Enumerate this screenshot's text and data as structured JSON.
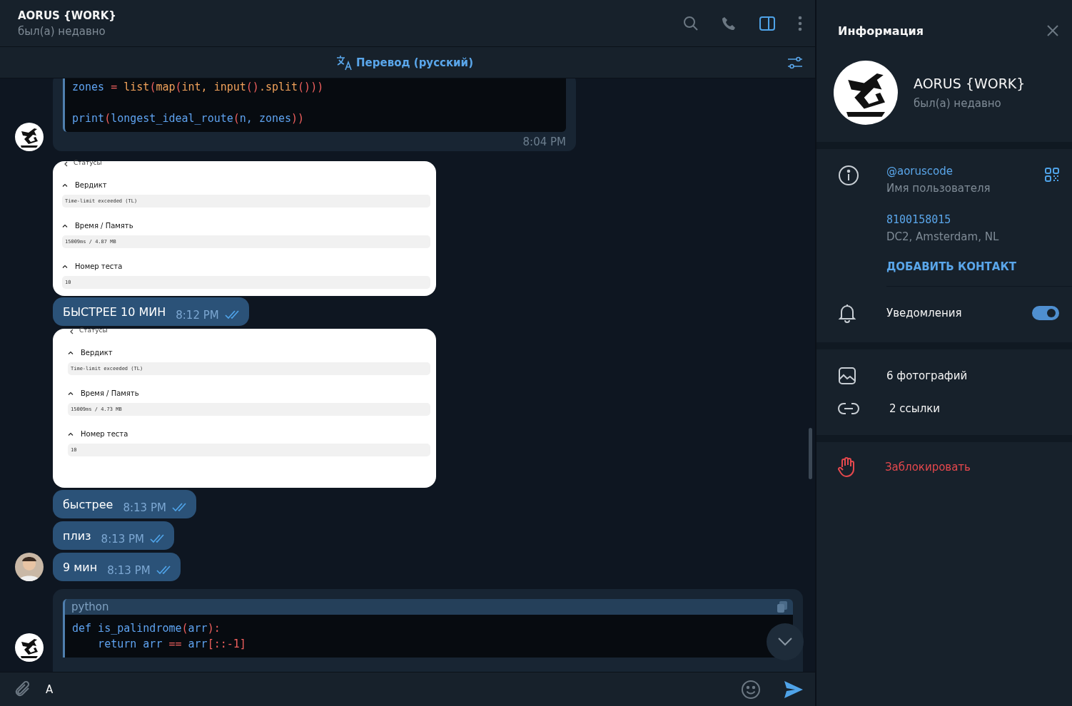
{
  "chat_header": {
    "title": "AORUS {WORK}",
    "status": "был(а) недавно"
  },
  "translate_bar": {
    "label": "Перевод (русский)"
  },
  "messages": [
    {
      "kind": "code",
      "avatar": {
        "kind": "logo"
      },
      "time": "8:04 PM",
      "lines": [
        {
          "kind": "code",
          "tokens": [
            {
              "t": "zones",
              "kind": "name"
            },
            {
              "t": " = ",
              "kind": "punct"
            },
            {
              "t": "list",
              "kind": "builtin"
            },
            {
              "t": "(",
              "kind": "punct"
            },
            {
              "t": "map",
              "kind": "builtin"
            },
            {
              "t": "(",
              "kind": "punct"
            },
            {
              "t": "int, input",
              "kind": "builtin"
            },
            {
              "t": "()",
              "kind": "punct"
            },
            {
              "t": ".split",
              "kind": "builtin"
            },
            {
              "t": "()))",
              "kind": "punct"
            }
          ]
        },
        {
          "kind": "blank"
        },
        {
          "kind": "code",
          "tokens": [
            {
              "t": "print",
              "kind": "name"
            },
            {
              "t": "(",
              "kind": "punct"
            },
            {
              "t": "longest_ideal_route",
              "kind": "name"
            },
            {
              "t": "(",
              "kind": "punct"
            },
            {
              "t": "n, zones",
              "kind": "name"
            },
            {
              "t": "))",
              "kind": "punct"
            }
          ]
        }
      ]
    },
    {
      "kind": "screenshot",
      "back": "Статусы",
      "sections": [
        {
          "heading": "Вердикт",
          "value": "Time-limit exceeded (TL)"
        },
        {
          "heading": "Время / Память",
          "value": "15009ms / 4.87 MB"
        },
        {
          "heading": "Номер теста",
          "value": "10"
        }
      ]
    },
    {
      "kind": "text",
      "text": "БЫСТРЕЕ 10 МИН",
      "time": "8:12 PM",
      "read": true
    },
    {
      "kind": "screenshot",
      "back": "Статусы",
      "sections": [
        {
          "heading": "Вердикт",
          "value": "Time-limit exceeded (TL)"
        },
        {
          "heading": "Время / Память",
          "value": "15009ms / 4.73 MB"
        },
        {
          "heading": "Номер теста",
          "value": "10"
        }
      ]
    },
    {
      "kind": "text",
      "text": "быстрее",
      "time": "8:13 PM",
      "read": true
    },
    {
      "kind": "text",
      "text": "плиз",
      "time": "8:13 PM",
      "read": true
    },
    {
      "kind": "text",
      "text": "9 мин",
      "time": "8:13 PM",
      "read": true,
      "avatar": {
        "kind": "person"
      }
    },
    {
      "kind": "code_block",
      "avatar": {
        "kind": "logo"
      },
      "language": "python",
      "lines": [
        {
          "kind": "code",
          "tokens": [
            {
              "t": "def is_palindrome",
              "kind": "name"
            },
            {
              "t": "(",
              "kind": "punct"
            },
            {
              "t": "arr",
              "kind": "name"
            },
            {
              "t": "):",
              "kind": "punct"
            }
          ]
        },
        {
          "kind": "code",
          "tokens": [
            {
              "t": "    return arr ",
              "kind": "name"
            },
            {
              "t": "==",
              "kind": "punct"
            },
            {
              "t": " arr",
              "kind": "name"
            },
            {
              "t": "[::-1]",
              "kind": "punct"
            }
          ]
        }
      ]
    }
  ],
  "composer": {
    "value": "A"
  },
  "info_panel": {
    "title": "Информация",
    "name": "AORUS {WORK}",
    "status": "был(а) недавно",
    "username": "@aoruscode",
    "username_label": "Имя пользователя",
    "id": "8100158015",
    "dc": "DC2, Amsterdam, NL",
    "add_contact": "ДОБАВИТЬ КОНТАКТ",
    "notifications": {
      "label": "Уведомления",
      "on": true
    },
    "media": [
      {
        "kind": "photos",
        "label": "6 фотографий"
      },
      {
        "kind": "links",
        "label": "2 ссылки"
      }
    ],
    "block": "Заблокировать"
  }
}
